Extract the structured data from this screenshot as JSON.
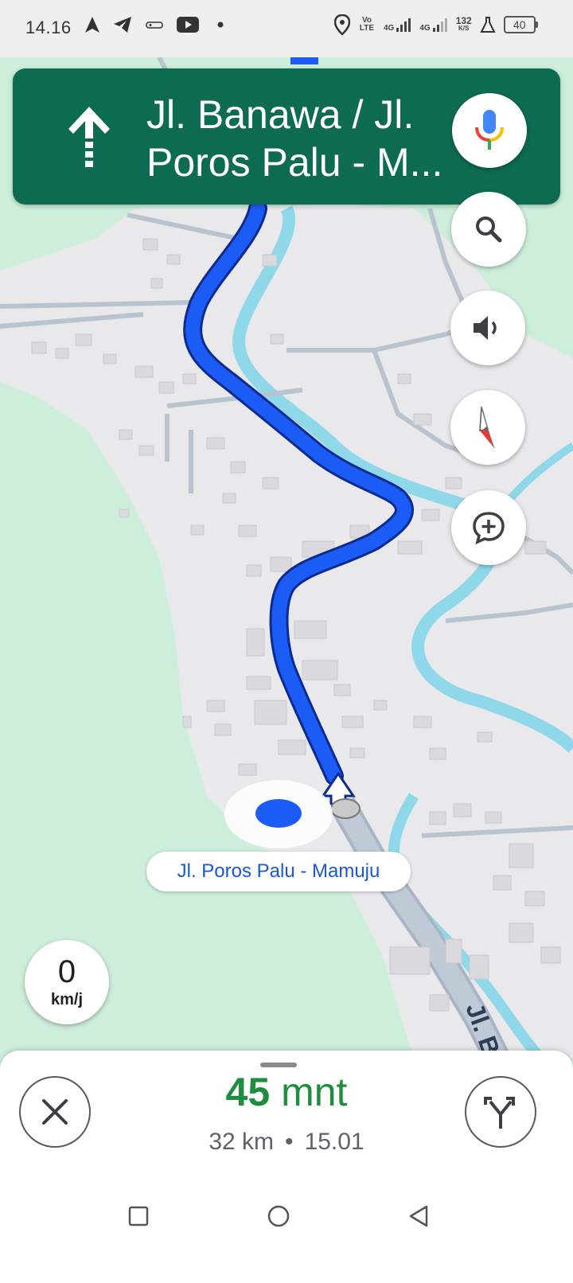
{
  "status_bar": {
    "time": "14.16",
    "volte_label": "Vo\nLTE",
    "net1_label": "4G",
    "net2_label": "4G",
    "net_speed_value": "132",
    "net_speed_unit": "K/S",
    "battery": "40"
  },
  "direction": {
    "street": "Jl. Banawa / Jl.\nPoros Palu - M...",
    "maneuver_icon": "straight-arrow-icon"
  },
  "map_controls": [
    {
      "name": "search-button",
      "icon": "search-icon"
    },
    {
      "name": "sound-button",
      "icon": "speaker-icon"
    },
    {
      "name": "compass-button",
      "icon": "compass-icon"
    },
    {
      "name": "add-report-button",
      "icon": "add-comment-icon"
    }
  ],
  "map": {
    "current_road": "Jl. Poros Palu - Mamuju",
    "road_label_partial": "Jl. B",
    "route_color": "#1a5cf5"
  },
  "speed": {
    "value": "0",
    "unit": "km/j"
  },
  "trip": {
    "eta_minutes": "45",
    "eta_unit": "mnt",
    "distance": "32 km",
    "separator": "•",
    "arrival_time": "15.01",
    "eta_color": "#1e8e3e"
  },
  "colors": {
    "banner": "#0d6b52",
    "land": "#cdeedb",
    "built_area": "#e9e9ec",
    "water": "#8fd8ea"
  }
}
